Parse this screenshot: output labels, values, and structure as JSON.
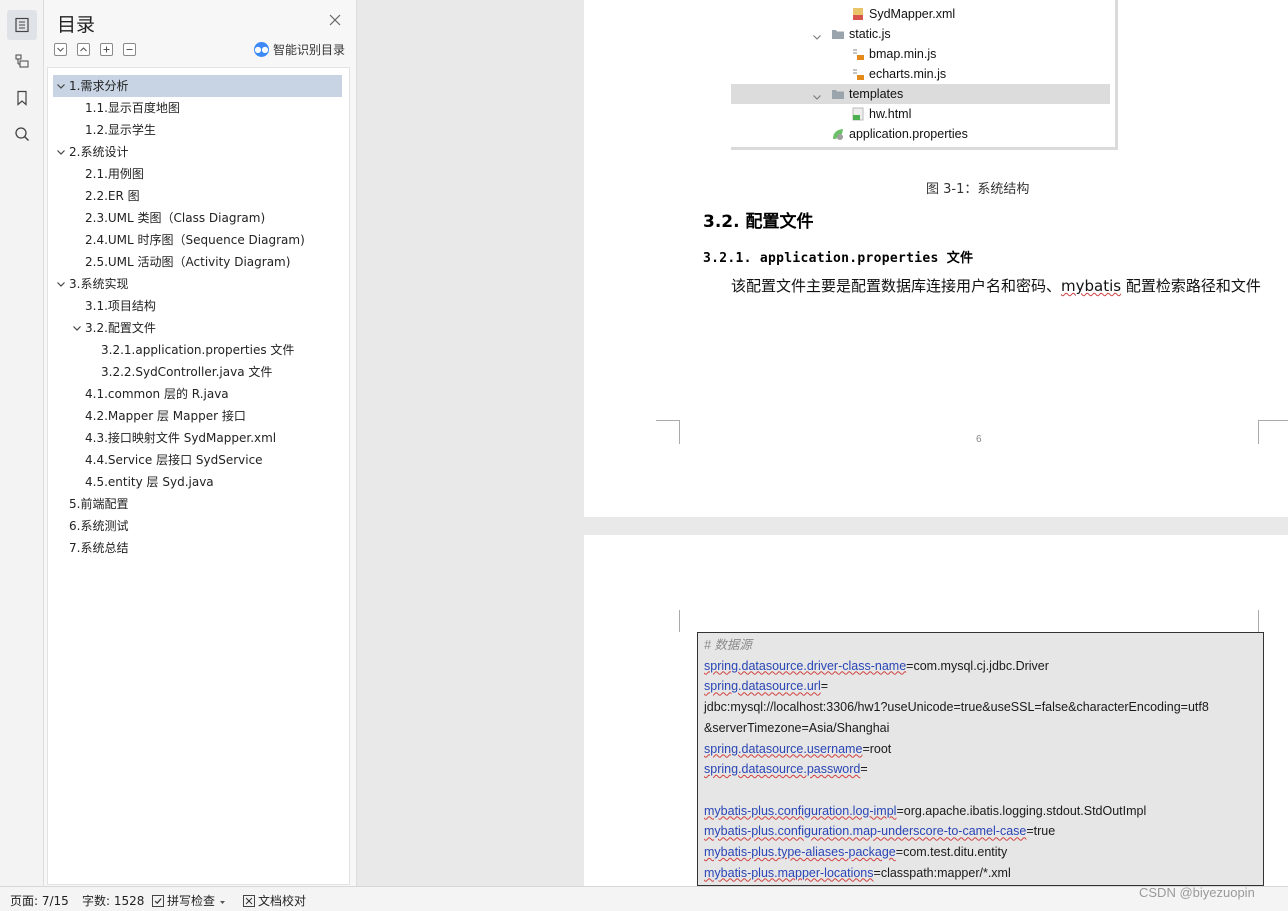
{
  "toc": {
    "title": "目录",
    "smart_label": "智能识别目录",
    "tools": [
      "-",
      "^",
      "+",
      "−"
    ],
    "items": [
      {
        "label": "1.需求分析",
        "level": 1,
        "expand": "down",
        "selected": true
      },
      {
        "label": "1.1.显示百度地图",
        "level": 2
      },
      {
        "label": "1.2.显示学生",
        "level": 2
      },
      {
        "label": "2.系统设计",
        "level": 1,
        "expand": "down"
      },
      {
        "label": "2.1.用例图",
        "level": 2
      },
      {
        "label": "2.2.ER 图",
        "level": 2
      },
      {
        "label": "2.3.UML 类图（Class Diagram)",
        "level": 2
      },
      {
        "label": "2.4.UML 时序图（Sequence Diagram)",
        "level": 2
      },
      {
        "label": "2.5.UML 活动图（Activity Diagram)",
        "level": 2
      },
      {
        "label": "3.系统实现",
        "level": 1,
        "expand": "down"
      },
      {
        "label": "3.1.项目结构",
        "level": 2
      },
      {
        "label": "3.2.配置文件",
        "level": 2,
        "expand": "down"
      },
      {
        "label": "3.2.1.application.properties 文件",
        "level": 3
      },
      {
        "label": "3.2.2.SydController.java 文件",
        "level": 3
      },
      {
        "label": "4.1.common 层的 R.java",
        "level": 2
      },
      {
        "label": "4.2.Mapper 层 Mapper  接口",
        "level": 2
      },
      {
        "label": "4.3.接口映射文件 SydMapper.xml",
        "level": 2
      },
      {
        "label": "4.4.Service 层接口 SydService",
        "level": 2
      },
      {
        "label": "4.5.entity 层 Syd.java",
        "level": 2
      },
      {
        "label": "5.前端配置",
        "level": 1
      },
      {
        "label": "6.系统测试",
        "level": 1
      },
      {
        "label": "7.系统总结",
        "level": 1
      }
    ]
  },
  "doc": {
    "tree": [
      {
        "label": "SydMapper.xml",
        "type": "xml",
        "indent": 2
      },
      {
        "label": "static.js",
        "type": "folder",
        "indent": 1,
        "chevron": true
      },
      {
        "label": "bmap.min.js",
        "type": "js",
        "indent": 2
      },
      {
        "label": "echarts.min.js",
        "type": "js",
        "indent": 2
      },
      {
        "label": "templates",
        "type": "folder",
        "indent": 1,
        "chevron": true,
        "highlight": true
      },
      {
        "label": "hw.html",
        "type": "html",
        "indent": 2
      },
      {
        "label": "application.properties",
        "type": "props",
        "indent": 1
      }
    ],
    "caption": "图 3-1：系统结构",
    "heading2": "3.2. 配置文件",
    "heading3": "3.2.1. application.properties 文件",
    "para_a": "该配置文件主要是配置数据库连接用户名和密码、",
    "para_b": "mybatis",
    "para_c": " 配置检索路径和文件",
    "page_number": "6",
    "code": [
      {
        "k": "",
        "v": "# 数据源",
        "comment": true
      },
      {
        "k": "spring.datasource.driver-class-name",
        "v": "=com.mysql.cj.jdbc.Driver"
      },
      {
        "k": "spring.datasource.url",
        "v": "="
      },
      {
        "k": "",
        "v": "jdbc:mysql://localhost:3306/hw1?useUnicode=true&useSSL=false&characterEncoding=utf8"
      },
      {
        "k": "",
        "v": "&serverTimezone=Asia/Shanghai"
      },
      {
        "k": "spring.datasource.username",
        "v": "=root"
      },
      {
        "k": "spring.datasource.password",
        "v": "="
      },
      {
        "k": "",
        "v": ""
      },
      {
        "k": "mybatis-plus.configuration.log-impl",
        "v": "=org.apache.ibatis.logging.stdout.StdOutImpl"
      },
      {
        "k": "mybatis-plus.configuration.map-underscore-to-camel-case",
        "v": "=true"
      },
      {
        "k": "mybatis-plus.type-aliases-package",
        "v": "=com.test.ditu.entity"
      },
      {
        "k": "mybatis-plus.mapper-locations",
        "v": "=classpath:mapper/*.xml"
      }
    ]
  },
  "status": {
    "page": "页面: 7/15",
    "words": "字数: 1528",
    "spell": "拼写检查",
    "proof": "文档校对"
  },
  "watermark": "CSDN @biyezuopin",
  "colors": {
    "accent": "#3d8af7",
    "selected": "#c8d4e3",
    "code_key": "#2a45b5"
  }
}
